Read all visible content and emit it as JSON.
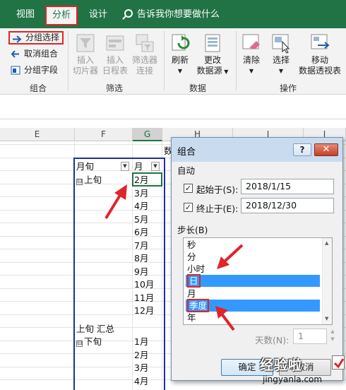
{
  "tabs": [
    "视图",
    "分析",
    "设计"
  ],
  "tell_me": "告诉我你想要做什么",
  "ribbon": {
    "group_grouping": {
      "label": "组合",
      "buttons": [
        "分组选择",
        "取消组合",
        "分组字段"
      ]
    },
    "group_filter": {
      "label": "筛选",
      "buttons": [
        [
          "插入",
          "切片器"
        ],
        [
          "插入",
          "日程表"
        ],
        [
          "筛选器",
          "连接"
        ]
      ]
    },
    "group_data": {
      "label": "数据",
      "buttons": [
        [
          "刷新",
          ""
        ],
        [
          "更改",
          "数据源"
        ]
      ]
    },
    "group_actions": {
      "label": "操作",
      "buttons": [
        [
          "清除",
          ""
        ],
        [
          "选择",
          ""
        ],
        [
          "移动",
          "数据透视表"
        ]
      ]
    }
  },
  "columns": [
    "E",
    "F",
    "G",
    "H",
    "I",
    "J"
  ],
  "pivot": {
    "header_row": [
      "月旬",
      "月"
    ],
    "truncated_header": "数",
    "group1": "上旬",
    "months1": [
      "2月",
      "3月",
      "4月",
      "5月",
      "6月",
      "7月",
      "8月",
      "9月",
      "10月",
      "11月",
      "12月"
    ],
    "subtotal": "上旬 汇总",
    "group2": "下旬",
    "months2": [
      "1月",
      "2月",
      "3月",
      "4月"
    ],
    "expander": "⊟"
  },
  "dialog": {
    "title": "组合",
    "help": "?",
    "close": "✕",
    "auto_section": "自动",
    "start_label": "起始于(S):",
    "start_value": "2018/1/15",
    "end_label": "终止于(E):",
    "end_value": "2018/12/30",
    "step_section": "步长(B)",
    "steps": [
      "秒",
      "分",
      "小时",
      "日",
      "月",
      "季度",
      "年"
    ],
    "days_label": "天数(N):",
    "days_value": "1",
    "ok": "确定",
    "cancel": "取消"
  },
  "watermark": {
    "text": "经验啦",
    "url": "jingyanla.com"
  },
  "colors": {
    "excel_green": "#217346",
    "highlight_red": "#e0242a",
    "pivot_border": "#1f2f99",
    "selection_blue": "#3399ff"
  }
}
